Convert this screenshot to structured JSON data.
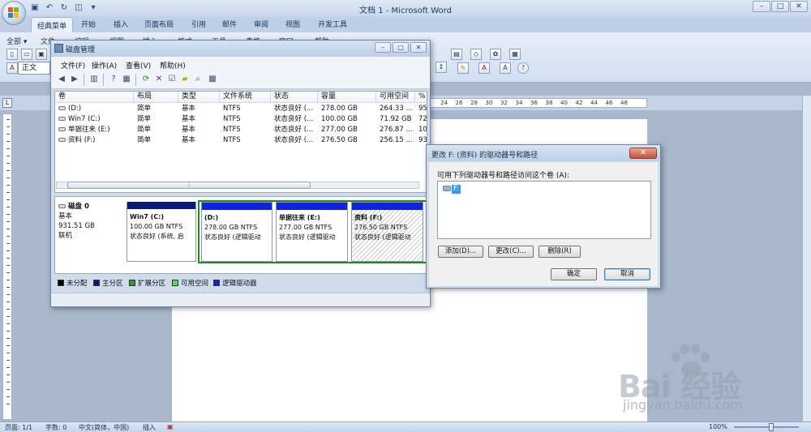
{
  "word": {
    "title": "文档 1 - Microsoft Word",
    "tabs": [
      "经典菜单",
      "开始",
      "插入",
      "页面布局",
      "引用",
      "邮件",
      "审阅",
      "视图",
      "开发工具"
    ],
    "ribbon_menu_all": "全部 ▾",
    "ribbon_menus": [
      "文件",
      "编辑",
      "视图",
      "插入",
      "格式",
      "工具",
      "表格",
      "窗口",
      "帮助"
    ],
    "style_box": "正文",
    "ruler_numbers": [
      "24",
      "26",
      "28",
      "30",
      "32",
      "34",
      "36",
      "38",
      "40",
      "42",
      "44",
      "46",
      "48"
    ],
    "window_controls": {
      "minimize": "–",
      "maximize": "□",
      "close": "✕"
    },
    "status": {
      "page": "页面: 1/1",
      "words": "字数: 0",
      "language": "中文(简体，中国)",
      "mode": "插入",
      "zoom": "100%"
    }
  },
  "disk_mgmt": {
    "title": "磁盘管理",
    "menus": [
      "文件(F)",
      "操作(A)",
      "查看(V)",
      "帮助(H)"
    ],
    "columns": [
      "卷",
      "布局",
      "类型",
      "文件系统",
      "状态",
      "容量",
      "可用空间",
      "%"
    ],
    "volumes": [
      [
        "(D:)",
        "简单",
        "基本",
        "NTFS",
        "状态良好 (...",
        "278.00 GB",
        "264.33 ...",
        "95"
      ],
      [
        "Win7 (C:)",
        "简单",
        "基本",
        "NTFS",
        "状态良好 (...",
        "100.00 GB",
        "71.92 GB",
        "72"
      ],
      [
        "单据往来 (E:)",
        "简单",
        "基本",
        "NTFS",
        "状态良好 (...",
        "277.00 GB",
        "276.87 ...",
        "100"
      ],
      [
        "资料 (F:)",
        "简单",
        "基本",
        "NTFS",
        "状态良好 (...",
        "276.50 GB",
        "256.15 ...",
        "93"
      ]
    ],
    "disk": {
      "name": "磁盘 0",
      "type": "基本",
      "size": "931.51 GB",
      "state": "联机"
    },
    "partitions": [
      {
        "name": "Win7  (C:)",
        "size": "100.00 GB NTFS",
        "status": "状态良好 (系统, 启",
        "bar_color": "#0a1a7a"
      },
      {
        "name": "(D:)",
        "size": "278.00 GB NTFS",
        "status": "状态良好 (逻辑驱动",
        "bar_color": "#1122dd"
      },
      {
        "name": "单据往来  (E:)",
        "size": "277.00 GB NTFS",
        "status": "状态良好 (逻辑驱动",
        "bar_color": "#1122dd"
      },
      {
        "name": "资料  (F:)",
        "size": "276.50 GB NTFS",
        "status": "状态良好 (逻辑驱动",
        "bar_color": "#1122dd"
      }
    ],
    "legend": [
      {
        "label": "未分配",
        "color": "#000000"
      },
      {
        "label": "主分区",
        "color": "#0a1a7a"
      },
      {
        "label": "扩展分区",
        "color": "#2b9c2b"
      },
      {
        "label": "可用空间",
        "color": "#55dd55"
      },
      {
        "label": "逻辑驱动器",
        "color": "#1122dd"
      }
    ]
  },
  "dialog": {
    "title": "更改 F: (资料) 的驱动器号和路径",
    "prompt": "可用下列驱动器号和路径访问这个卷 (A):",
    "list_item": "F:",
    "add_button": "添加(D)...",
    "change_button": "更改(C)...",
    "delete_button": "删除(R)",
    "ok_button": "确定",
    "cancel_button": "取消"
  },
  "watermark": {
    "url": "jingyan.baidu.com"
  }
}
